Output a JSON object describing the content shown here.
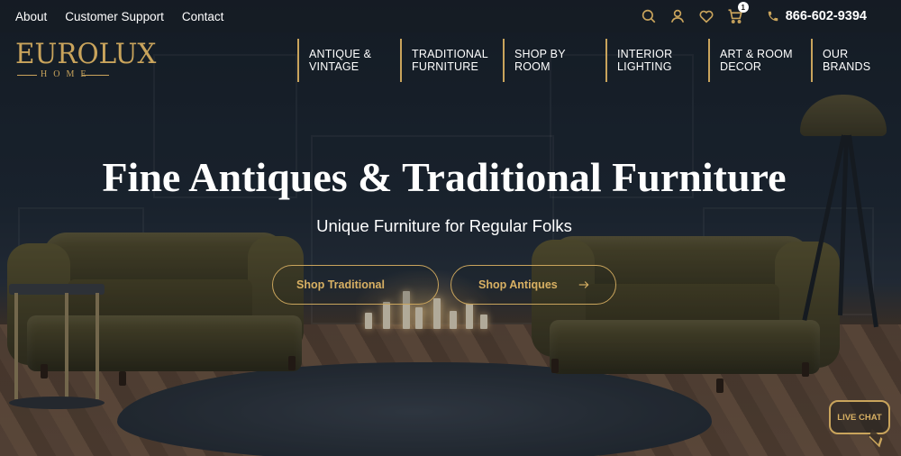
{
  "topbar": {
    "links": [
      "About",
      "Customer Support",
      "Contact"
    ],
    "cart_count": "1",
    "phone": "866-602-9394",
    "icons": [
      "search-icon",
      "account-icon",
      "heart-icon",
      "cart-icon",
      "phone-icon"
    ]
  },
  "brand": {
    "logo_main": "EUROLUX",
    "logo_sub": "HOME",
    "accent_color": "#c9a45c"
  },
  "nav": {
    "items": [
      {
        "line1": "ANTIQUE &",
        "line2": "VINTAGE"
      },
      {
        "line1": "TRADITIONAL",
        "line2": "FURNITURE"
      },
      {
        "line1": "SHOP BY",
        "line2": "ROOM"
      },
      {
        "line1": "INTERIOR",
        "line2": "LIGHTING"
      },
      {
        "line1": "ART & ROOM",
        "line2": "DECOR"
      },
      {
        "line1": "OUR",
        "line2": "BRANDS"
      }
    ]
  },
  "hero": {
    "title": "Fine Antiques & Traditional Furniture",
    "subtitle": "Unique Furniture for Regular Folks",
    "buttons": [
      "Shop Traditional",
      "Shop Antiques"
    ]
  },
  "chat": {
    "label": "LIVE CHAT"
  }
}
